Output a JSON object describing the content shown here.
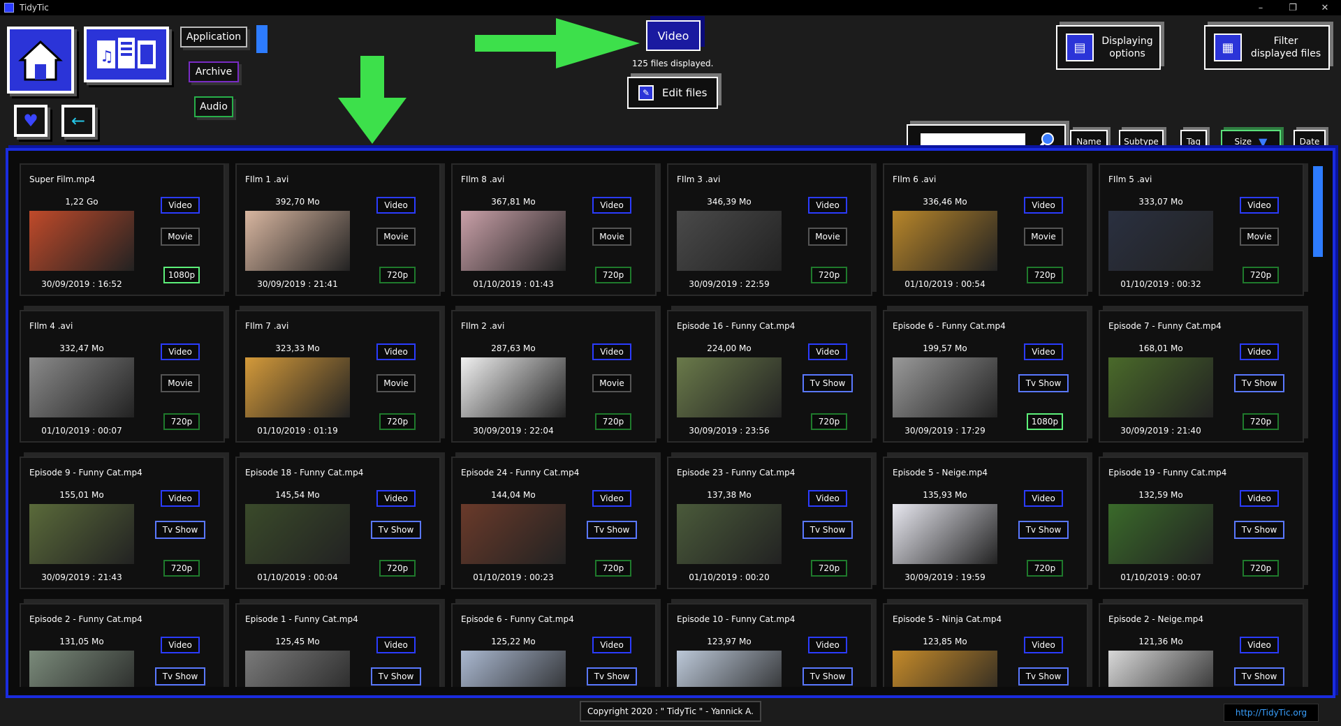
{
  "window": {
    "title": "TidyTic",
    "controls": [
      "–",
      "❐",
      "✕"
    ]
  },
  "nav": {
    "application_label": "Application",
    "archive_label": "Archive",
    "audio_label": "Audio"
  },
  "current_category": {
    "label": "Video",
    "files_displayed": "125 files displayed."
  },
  "edit_files_label": "Edit files",
  "displaying_options_label_1": "Displaying",
  "displaying_options_label_2": "options",
  "filter_label_1": "Filter",
  "filter_label_2": "displayed files",
  "search": {
    "value": ""
  },
  "sort": {
    "name": "Name",
    "subtype": "Subtype",
    "tag": "Tag",
    "size": "Size",
    "date": "Date"
  },
  "colors": {
    "accent_blue": "#1a2cdf",
    "arrow_green": "#3de04b",
    "hd_green": "#5df07a"
  },
  "files": [
    {
      "name": "Super Film.mp4",
      "size": "1,22 Go",
      "date": "30/09/2019 : 16:52",
      "type": "Video",
      "category": "Movie",
      "res": "1080p"
    },
    {
      "name": "FIlm 1 .avi",
      "size": "392,70 Mo",
      "date": "30/09/2019 : 21:41",
      "type": "Video",
      "category": "Movie",
      "res": "720p"
    },
    {
      "name": "FIlm 8 .avi",
      "size": "367,81 Mo",
      "date": "01/10/2019 : 01:43",
      "type": "Video",
      "category": "Movie",
      "res": "720p"
    },
    {
      "name": "FIlm 3 .avi",
      "size": "346,39 Mo",
      "date": "30/09/2019 : 22:59",
      "type": "Video",
      "category": "Movie",
      "res": "720p"
    },
    {
      "name": "FIlm 6 .avi",
      "size": "336,46 Mo",
      "date": "01/10/2019 : 00:54",
      "type": "Video",
      "category": "Movie",
      "res": "720p"
    },
    {
      "name": "FIlm 5 .avi",
      "size": "333,07 Mo",
      "date": "01/10/2019 : 00:32",
      "type": "Video",
      "category": "Movie",
      "res": "720p"
    },
    {
      "name": "FIlm 4 .avi",
      "size": "332,47 Mo",
      "date": "01/10/2019 : 00:07",
      "type": "Video",
      "category": "Movie",
      "res": "720p"
    },
    {
      "name": "FIlm 7 .avi",
      "size": "323,33 Mo",
      "date": "01/10/2019 : 01:19",
      "type": "Video",
      "category": "Movie",
      "res": "720p"
    },
    {
      "name": "FIlm 2 .avi",
      "size": "287,63 Mo",
      "date": "30/09/2019 : 22:04",
      "type": "Video",
      "category": "Movie",
      "res": "720p"
    },
    {
      "name": "Episode 16 - Funny Cat.mp4",
      "size": "224,00 Mo",
      "date": "30/09/2019 : 23:56",
      "type": "Video",
      "category": "Tv Show",
      "res": "720p"
    },
    {
      "name": "Episode 6 - Funny Cat.mp4",
      "size": "199,57 Mo",
      "date": "30/09/2019 : 17:29",
      "type": "Video",
      "category": "Tv Show",
      "res": "1080p"
    },
    {
      "name": "Episode 7 - Funny Cat.mp4",
      "size": "168,01 Mo",
      "date": "30/09/2019 : 21:40",
      "type": "Video",
      "category": "Tv Show",
      "res": "720p"
    },
    {
      "name": "Episode 9 - Funny Cat.mp4",
      "size": "155,01 Mo",
      "date": "30/09/2019 : 21:43",
      "type": "Video",
      "category": "Tv Show",
      "res": "720p"
    },
    {
      "name": "Episode 18 - Funny Cat.mp4",
      "size": "145,54 Mo",
      "date": "01/10/2019 : 00:04",
      "type": "Video",
      "category": "Tv Show",
      "res": "720p"
    },
    {
      "name": "Episode 24 - Funny Cat.mp4",
      "size": "144,04 Mo",
      "date": "01/10/2019 : 00:23",
      "type": "Video",
      "category": "Tv Show",
      "res": "720p"
    },
    {
      "name": "Episode 23 - Funny Cat.mp4",
      "size": "137,38 Mo",
      "date": "01/10/2019 : 00:20",
      "type": "Video",
      "category": "Tv Show",
      "res": "720p"
    },
    {
      "name": "Episode 5 - Neige.mp4",
      "size": "135,93 Mo",
      "date": "30/09/2019 : 19:59",
      "type": "Video",
      "category": "Tv Show",
      "res": "720p"
    },
    {
      "name": "Episode 19 - Funny Cat.mp4",
      "size": "132,59 Mo",
      "date": "01/10/2019 : 00:07",
      "type": "Video",
      "category": "Tv Show",
      "res": "720p"
    },
    {
      "name": "Episode 2 - Funny Cat.mp4",
      "size": "131,05 Mo",
      "date": "",
      "type": "Video",
      "category": "Tv Show",
      "res": ""
    },
    {
      "name": "Episode 1 - Funny Cat.mp4",
      "size": "125,45 Mo",
      "date": "",
      "type": "Video",
      "category": "Tv Show",
      "res": ""
    },
    {
      "name": "Episode 6 - Funny Cat.mp4",
      "size": "125,22 Mo",
      "date": "",
      "type": "Video",
      "category": "Tv Show",
      "res": ""
    },
    {
      "name": "Episode 10 - Funny Cat.mp4",
      "size": "123,97 Mo",
      "date": "",
      "type": "Video",
      "category": "Tv Show",
      "res": ""
    },
    {
      "name": "Episode 5 - Ninja Cat.mp4",
      "size": "123,85 Mo",
      "date": "",
      "type": "Video",
      "category": "Tv Show",
      "res": ""
    },
    {
      "name": "Episode 2 - Neige.mp4",
      "size": "121,36 Mo",
      "date": "",
      "type": "Video",
      "category": "Tv Show",
      "res": ""
    }
  ],
  "footer": {
    "copyright": "Copyright 2020 : \" TidyTic \" - Yannick A.",
    "link": "http://TidyTic.org"
  }
}
